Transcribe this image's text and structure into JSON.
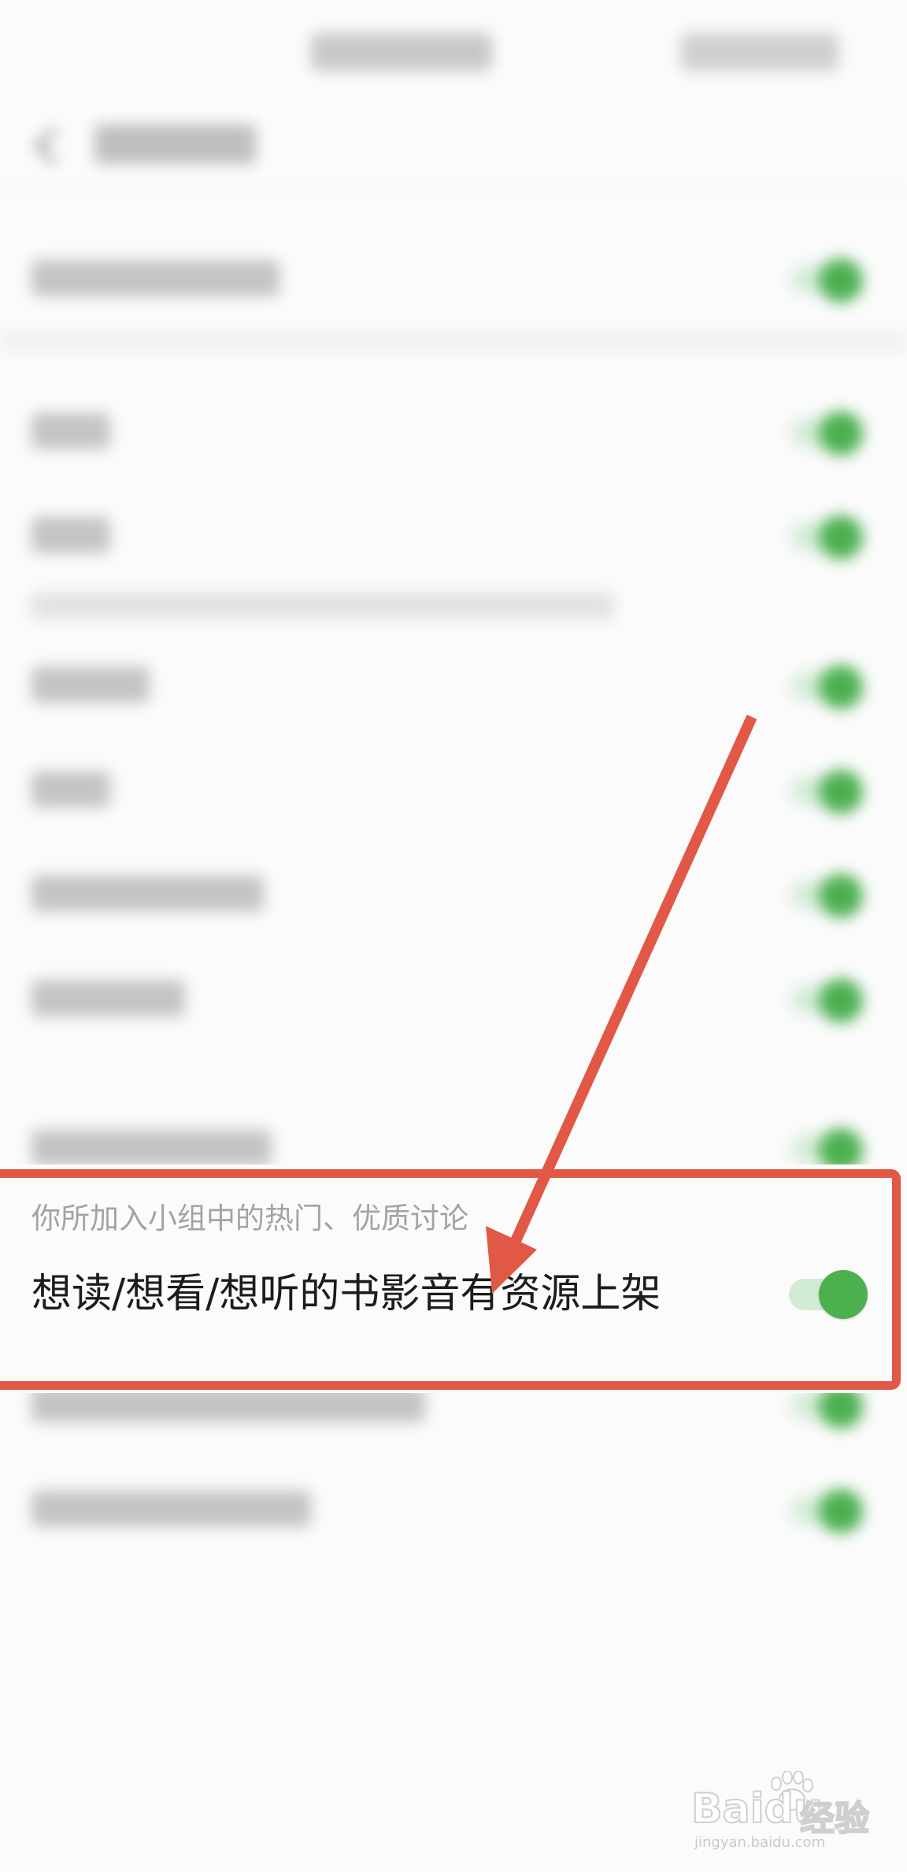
{
  "focus_setting": {
    "section_caption": "你所加入小组中的热门、优质讨论",
    "label": "想读/想看/想听的书影音有资源上架",
    "enabled": true
  },
  "watermark": {
    "brand": "Bai",
    "brand_suffix": "du",
    "brand_cn": "经验",
    "url": "jingyan.baidu.com"
  },
  "colors": {
    "switch_on": "#4cb050",
    "annotation": "#e15846"
  }
}
